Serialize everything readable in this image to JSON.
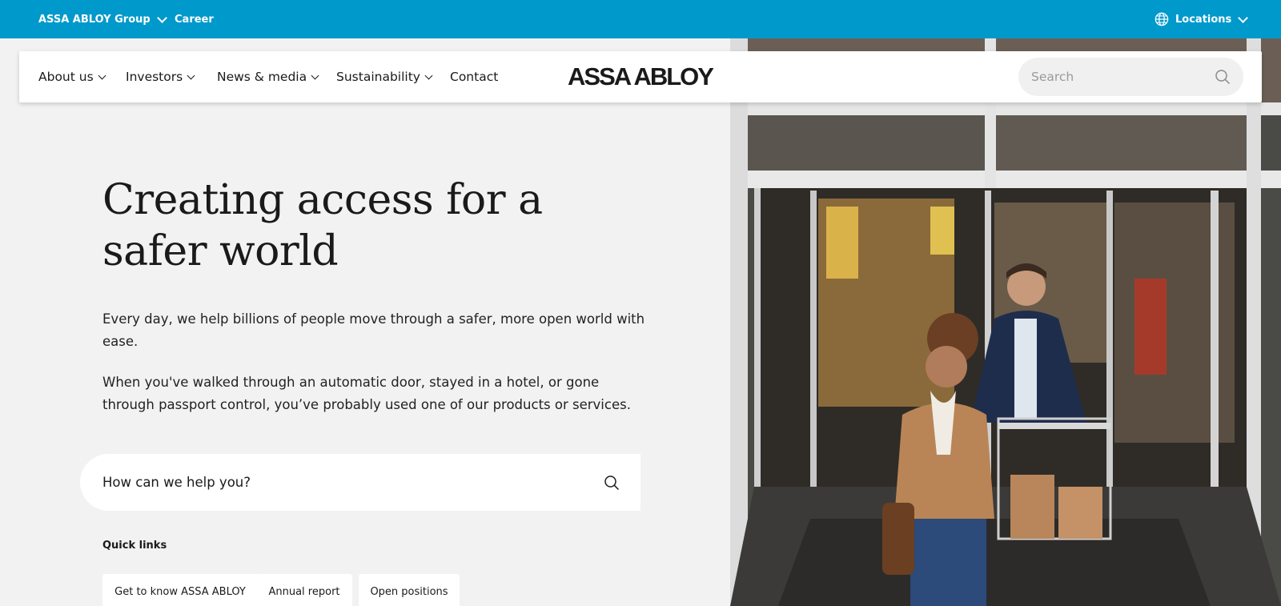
{
  "topbar": {
    "group_label": "ASSA ABLOY Group",
    "career_label": "Career",
    "locations_label": "Locations",
    "background_color": "#0099cc"
  },
  "nav": {
    "items": [
      {
        "label": "About us",
        "has_dropdown": true
      },
      {
        "label": "Investors",
        "has_dropdown": true
      },
      {
        "label": "News & media",
        "has_dropdown": true
      },
      {
        "label": "Sustainability",
        "has_dropdown": true
      },
      {
        "label": "Contact",
        "has_dropdown": false
      }
    ],
    "logo_text": "ASSA ABLOY",
    "search_placeholder": "Search"
  },
  "hero": {
    "headline": "Creating access for a safer world",
    "paragraph1": "Every day, we help billions of people move through a safer, more open world with ease.",
    "paragraph2": "When you've walked through an automatic door, stayed in a hotel, or gone through passport control, you’ve probably used one of our products or services.",
    "help_placeholder": "How can we help you?",
    "quick_links_title": "Quick links",
    "quick_links": [
      "Get to know ASSA ABLOY",
      "Annual report",
      "Open positions"
    ]
  }
}
